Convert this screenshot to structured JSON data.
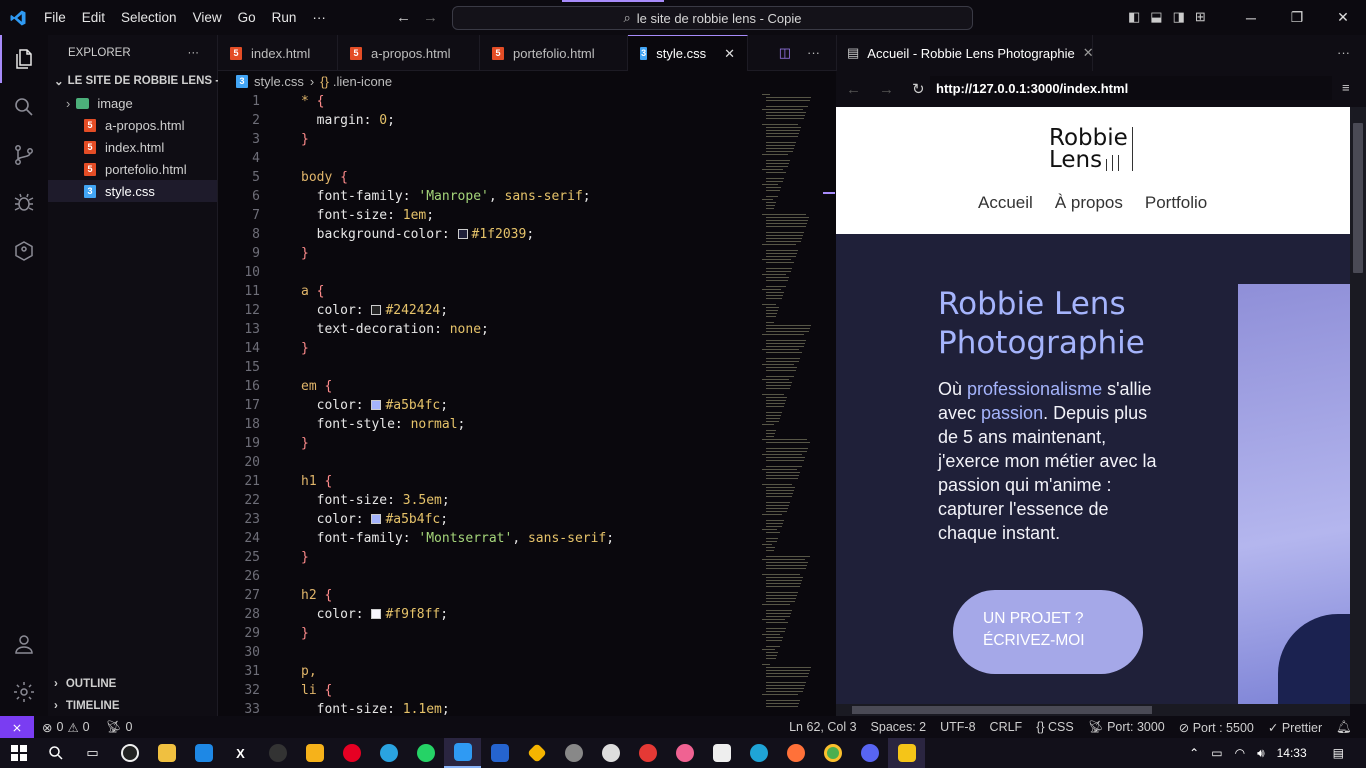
{
  "titlebar": {
    "menu": [
      "File",
      "Edit",
      "Selection",
      "View",
      "Go",
      "Run",
      "···"
    ],
    "search": "le site de robbie lens - Copie"
  },
  "explorer": {
    "header": "EXPLORER",
    "project": "LE SITE DE ROBBIE LENS - ...",
    "items": [
      {
        "label": "image",
        "kind": "folder"
      },
      {
        "label": "a-propos.html",
        "kind": "html"
      },
      {
        "label": "index.html",
        "kind": "html"
      },
      {
        "label": "portefolio.html",
        "kind": "html"
      },
      {
        "label": "style.css",
        "kind": "css",
        "selected": true
      }
    ],
    "outline": "OUTLINE",
    "timeline": "TIMELINE"
  },
  "tabs": [
    {
      "label": "index.html",
      "kind": "html"
    },
    {
      "label": "a-propos.html",
      "kind": "html"
    },
    {
      "label": "portefolio.html",
      "kind": "html"
    },
    {
      "label": "style.css",
      "kind": "css",
      "active": true
    }
  ],
  "breadcrumb": {
    "file": "style.css",
    "symbol": ".lien-icone"
  },
  "code_lines": [
    [
      {
        "t": "* ",
        "c": "sel"
      },
      {
        "t": "{",
        "c": "brace"
      }
    ],
    [
      {
        "t": "  margin",
        "c": "prop"
      },
      {
        "t": ": ",
        "c": "prop"
      },
      {
        "t": "0",
        "c": "val"
      },
      {
        "t": ";",
        "c": "prop"
      }
    ],
    [
      {
        "t": "}",
        "c": "brace"
      }
    ],
    [],
    [
      {
        "t": "body ",
        "c": "sel"
      },
      {
        "t": "{",
        "c": "brace"
      }
    ],
    [
      {
        "t": "  font-family",
        "c": "prop"
      },
      {
        "t": ": ",
        "c": "prop"
      },
      {
        "t": "'Manrope'",
        "c": "str"
      },
      {
        "t": ", ",
        "c": "prop"
      },
      {
        "t": "sans-serif",
        "c": "kw"
      },
      {
        "t": ";",
        "c": "prop"
      }
    ],
    [
      {
        "t": "  font-size",
        "c": "prop"
      },
      {
        "t": ": ",
        "c": "prop"
      },
      {
        "t": "1em",
        "c": "val"
      },
      {
        "t": ";",
        "c": "prop"
      }
    ],
    [
      {
        "t": "  background-color",
        "c": "prop"
      },
      {
        "t": ": ",
        "c": "prop"
      },
      {
        "t": "#1f2039",
        "c": "val",
        "swatch": "#1f2039"
      },
      {
        "t": ";",
        "c": "prop"
      }
    ],
    [
      {
        "t": "}",
        "c": "brace"
      }
    ],
    [],
    [
      {
        "t": "a ",
        "c": "sel"
      },
      {
        "t": "{",
        "c": "brace"
      }
    ],
    [
      {
        "t": "  color",
        "c": "prop"
      },
      {
        "t": ": ",
        "c": "prop"
      },
      {
        "t": "#242424",
        "c": "val",
        "swatch": "#242424"
      },
      {
        "t": ";",
        "c": "prop"
      }
    ],
    [
      {
        "t": "  text-decoration",
        "c": "prop"
      },
      {
        "t": ": ",
        "c": "prop"
      },
      {
        "t": "none",
        "c": "kw"
      },
      {
        "t": ";",
        "c": "prop"
      }
    ],
    [
      {
        "t": "}",
        "c": "brace"
      }
    ],
    [],
    [
      {
        "t": "em ",
        "c": "sel"
      },
      {
        "t": "{",
        "c": "brace"
      }
    ],
    [
      {
        "t": "  color",
        "c": "prop"
      },
      {
        "t": ": ",
        "c": "prop"
      },
      {
        "t": "#a5b4fc",
        "c": "val",
        "swatch": "#a5b4fc"
      },
      {
        "t": ";",
        "c": "prop"
      }
    ],
    [
      {
        "t": "  font-style",
        "c": "prop"
      },
      {
        "t": ": ",
        "c": "prop"
      },
      {
        "t": "normal",
        "c": "kw"
      },
      {
        "t": ";",
        "c": "prop"
      }
    ],
    [
      {
        "t": "}",
        "c": "brace"
      }
    ],
    [],
    [
      {
        "t": "h1 ",
        "c": "sel"
      },
      {
        "t": "{",
        "c": "brace"
      }
    ],
    [
      {
        "t": "  font-size",
        "c": "prop"
      },
      {
        "t": ": ",
        "c": "prop"
      },
      {
        "t": "3.5em",
        "c": "val"
      },
      {
        "t": ";",
        "c": "prop"
      }
    ],
    [
      {
        "t": "  color",
        "c": "prop"
      },
      {
        "t": ": ",
        "c": "prop"
      },
      {
        "t": "#a5b4fc",
        "c": "val",
        "swatch": "#a5b4fc"
      },
      {
        "t": ";",
        "c": "prop"
      }
    ],
    [
      {
        "t": "  font-family",
        "c": "prop"
      },
      {
        "t": ": ",
        "c": "prop"
      },
      {
        "t": "'Montserrat'",
        "c": "str"
      },
      {
        "t": ", ",
        "c": "prop"
      },
      {
        "t": "sans-serif",
        "c": "kw"
      },
      {
        "t": ";",
        "c": "prop"
      }
    ],
    [
      {
        "t": "}",
        "c": "brace"
      }
    ],
    [],
    [
      {
        "t": "h2 ",
        "c": "sel"
      },
      {
        "t": "{",
        "c": "brace"
      }
    ],
    [
      {
        "t": "  color",
        "c": "prop"
      },
      {
        "t": ": ",
        "c": "prop"
      },
      {
        "t": "#f9f8ff",
        "c": "val",
        "swatch": "#f9f8ff"
      },
      {
        "t": ";",
        "c": "prop"
      }
    ],
    [
      {
        "t": "}",
        "c": "brace"
      }
    ],
    [],
    [
      {
        "t": "p,",
        "c": "sel"
      }
    ],
    [
      {
        "t": "li ",
        "c": "sel"
      },
      {
        "t": "{",
        "c": "brace"
      }
    ],
    [
      {
        "t": "  font-size",
        "c": "prop"
      },
      {
        "t": ": ",
        "c": "prop"
      },
      {
        "t": "1.1em",
        "c": "val"
      },
      {
        "t": ";",
        "c": "prop"
      }
    ]
  ],
  "preview": {
    "tab_title": "Accueil - Robbie Lens Photographie",
    "url": "http://127.0.0.1:3000/index.html",
    "logo_line1": "Robbie",
    "logo_line2": "Lens",
    "nav": [
      "Accueil",
      "À propos",
      "Portfolio"
    ],
    "h1_line1": "Robbie Lens",
    "h1_line2": "Photographie",
    "para": [
      {
        "t": "Où "
      },
      {
        "t": "professionalisme",
        "em": true
      },
      {
        "t": " s'allie avec "
      },
      {
        "t": "passion",
        "em": true
      },
      {
        "t": ". Depuis plus de 5 ans maintenant, j'exerce mon métier avec la passion qui m'anime : capturer l'essence de chaque instant."
      }
    ],
    "cta_line1": "UN PROJET ?",
    "cta_line2": "ÉCRIVEZ-MOI"
  },
  "status": {
    "errors": "0",
    "warnings": "0",
    "ports": "0",
    "position": "Ln 62, Col 3",
    "spaces": "Spaces: 2",
    "encoding": "UTF-8",
    "eol": "CRLF",
    "language": "CSS",
    "port": "Port: 3000",
    "port2": "Port : 5500",
    "prettier": "Prettier"
  },
  "taskbar": {
    "time": "14:33"
  },
  "colors": {
    "accent": "#a78bfa",
    "site_bg": "#1f2039",
    "site_accent": "#a5b4fc"
  }
}
